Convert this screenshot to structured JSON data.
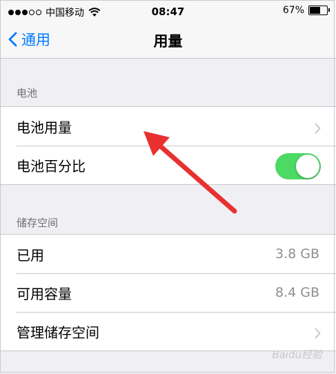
{
  "status_bar": {
    "carrier": "中国移动",
    "time": "08:47",
    "battery_percent": "67%",
    "battery_level": 0.67,
    "signal_bars_filled": 3,
    "signal_bars_total": 5,
    "icons": [
      "signal-dots-icon",
      "wifi-icon",
      "battery-icon"
    ]
  },
  "nav": {
    "back_label": "通用",
    "back_icon": "chevron-left-icon",
    "title": "用量"
  },
  "battery_section": {
    "header": "电池",
    "items": [
      {
        "label": "电池用量",
        "accessory": "chevron-right-icon"
      },
      {
        "label": "电池百分比",
        "toggle_on": true
      }
    ]
  },
  "storage_section": {
    "header": "储存空间",
    "items": [
      {
        "label": "已用",
        "value": "3.8 GB"
      },
      {
        "label": "可用容量",
        "value": "8.4 GB"
      },
      {
        "label": "管理储存空间",
        "accessory": "chevron-right-icon"
      }
    ]
  },
  "colors": {
    "accent": "#007aff",
    "toggle_on": "#4cd964",
    "annotation_arrow": "#e8312f",
    "background": "#efeff4"
  },
  "watermark": "Baidu经验"
}
